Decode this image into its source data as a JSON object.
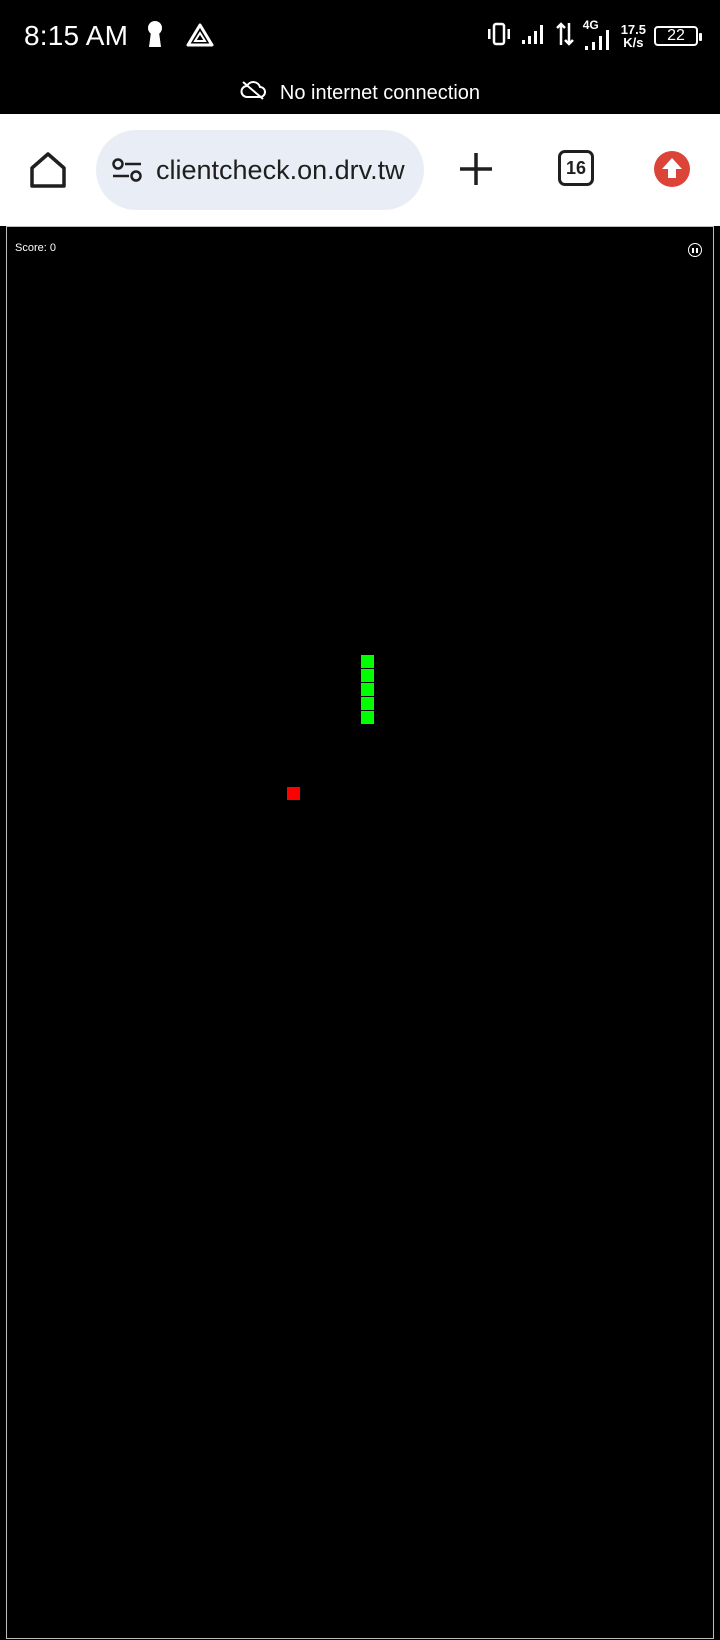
{
  "status_bar": {
    "time": "8:15 AM",
    "net_type": "4G",
    "speed_value": "17.5",
    "speed_unit": "K/s",
    "battery": "22"
  },
  "notice": {
    "text": "No internet connection",
    "icon": "cloud-off-icon"
  },
  "browser": {
    "url": "clientcheck.on.drv.tw",
    "tab_count": "16",
    "icons": [
      "home-icon",
      "tune-icon",
      "plus-icon",
      "tabs-icon",
      "update-icon"
    ]
  },
  "game": {
    "score_label": "Score:",
    "score": "0",
    "pause_icon": "pause-icon",
    "colors": {
      "snake": "#00ff00",
      "food": "#ff0000",
      "background": "#000000",
      "border": "#bdbdbd"
    }
  }
}
